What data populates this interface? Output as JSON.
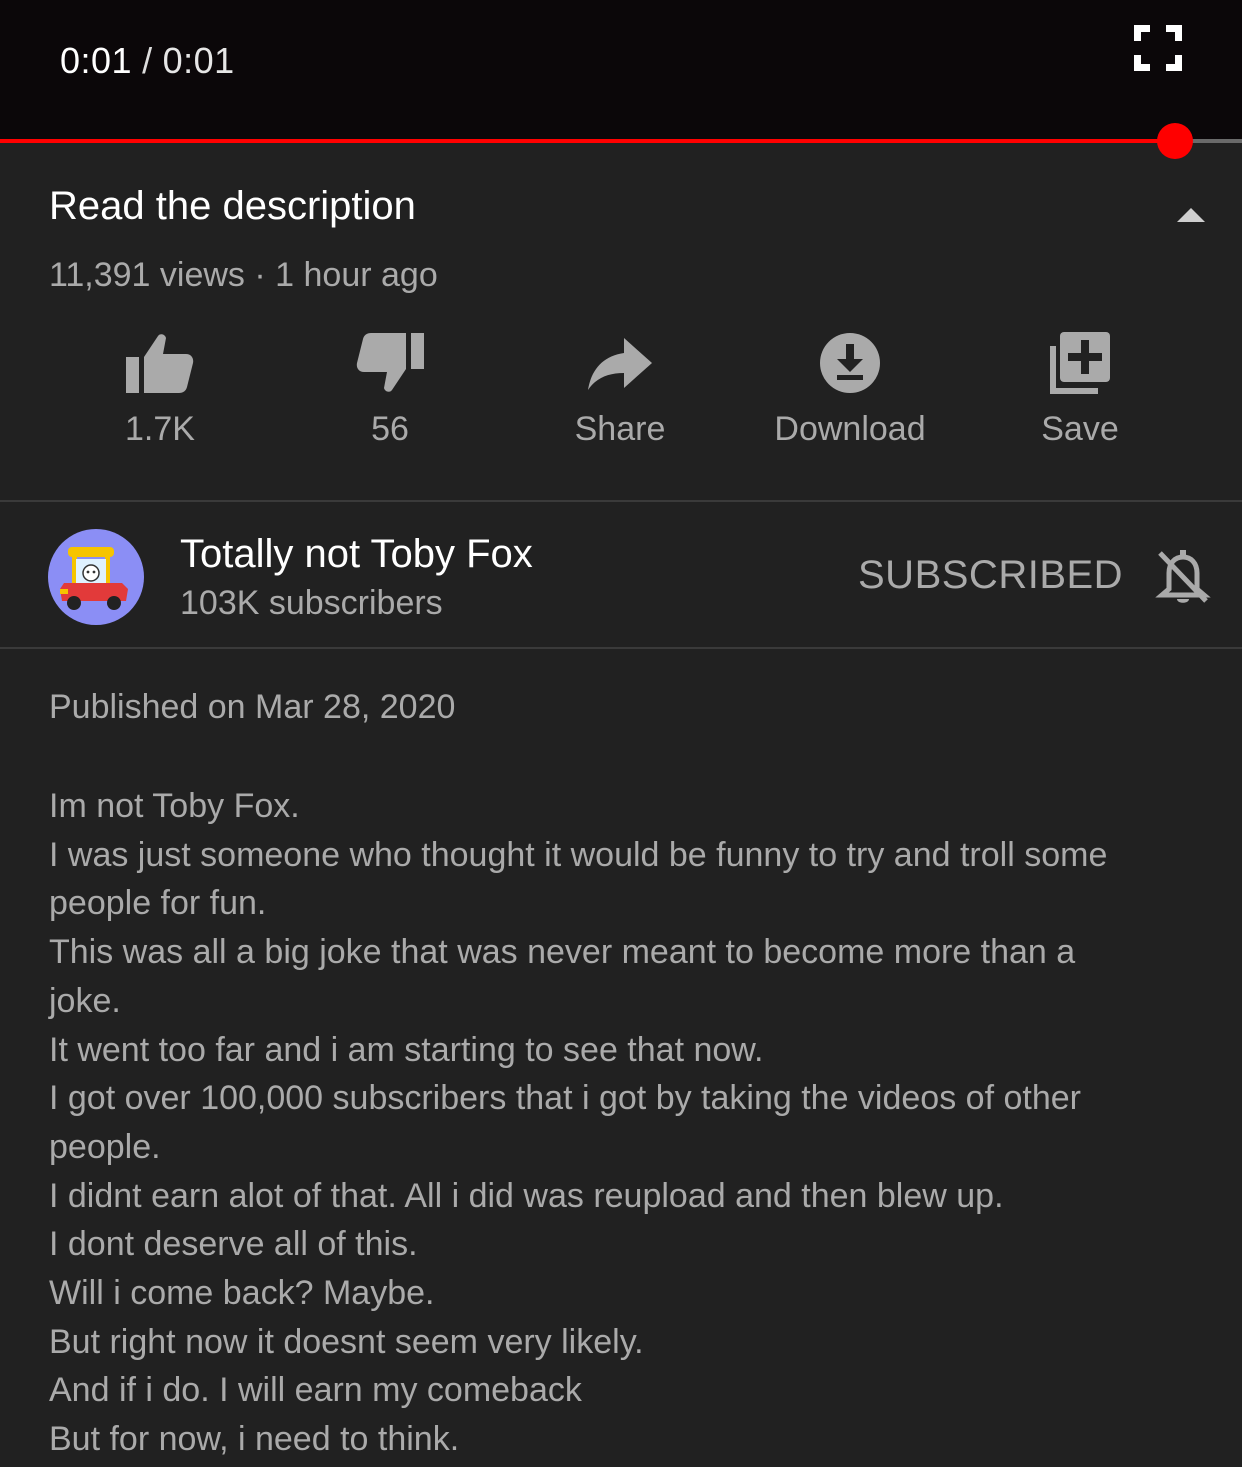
{
  "player": {
    "current_time": "0:01",
    "separator": "/",
    "duration": "0:01",
    "progress_fraction": 0.946,
    "progress_color": "#ff0000"
  },
  "video": {
    "title": "Read the description",
    "meta": "11,391 views · 1 hour ago"
  },
  "actions": {
    "like": {
      "icon": "thumbs-up-icon",
      "label": "1.7K"
    },
    "dislike": {
      "icon": "thumbs-down-icon",
      "label": "56"
    },
    "share": {
      "icon": "share-icon",
      "label": "Share"
    },
    "download": {
      "icon": "download-icon",
      "label": "Download"
    },
    "save": {
      "icon": "playlist-add-icon",
      "label": "Save"
    }
  },
  "channel": {
    "name": "Totally not Toby Fox",
    "subscribers": "103K subscribers",
    "subscribe_label": "SUBSCRIBED",
    "avatar_color": "#8b8ef5"
  },
  "description": {
    "published": "Published on Mar 28, 2020",
    "lines": [
      "Im not Toby Fox.",
      "I was just someone who thought it would be funny to try and troll some",
      "people for fun.",
      "This was all a big joke that was never meant to become more than a",
      "joke.",
      "It went too far and i am starting to see that now.",
      "I got over 100,000 subscribers that i got by taking the videos of other",
      "people.",
      "I didnt earn alot of that. All i did was reupload and then blew up.",
      "I dont deserve all of this.",
      "Will i come back? Maybe.",
      "But right now it doesnt seem very likely.",
      "And if i do. I will earn my comeback",
      "But for now, i need to think."
    ]
  }
}
